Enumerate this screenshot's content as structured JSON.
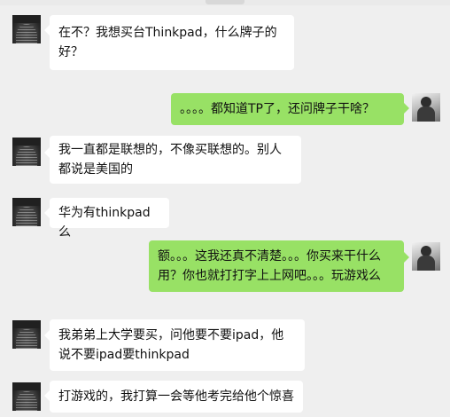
{
  "chat": {
    "messages": [
      {
        "side": "in",
        "avatar": "friend-avatar",
        "text": "在不？我想买台Thinkpad，什么牌子的好？"
      },
      {
        "side": "out",
        "avatar": "self-avatar",
        "text": "。。。。都知道TP了，还问牌子干啥？"
      },
      {
        "side": "in",
        "avatar": "friend-avatar",
        "text": "我一直都是联想的，不像买联想的。别人都说是美国的"
      },
      {
        "side": "in",
        "avatar": "friend-avatar",
        "text": "华为有thinkpad么"
      },
      {
        "side": "out",
        "avatar": "self-avatar",
        "text": "额。。。这我还真不清楚。。。你买来干什么用？你也就打打字上上网吧。。。玩游戏么"
      },
      {
        "side": "in",
        "avatar": "friend-avatar",
        "text": "我弟弟上大学要买，问他要不要ipad，他说不要ipad要thinkpad"
      },
      {
        "side": "in",
        "avatar": "friend-avatar",
        "text": "打游戏的，我打算一会等他考完给他个惊喜"
      }
    ]
  },
  "colors": {
    "background": "#efefef",
    "incoming_bubble": "#ffffff",
    "outgoing_bubble": "#98e165"
  }
}
